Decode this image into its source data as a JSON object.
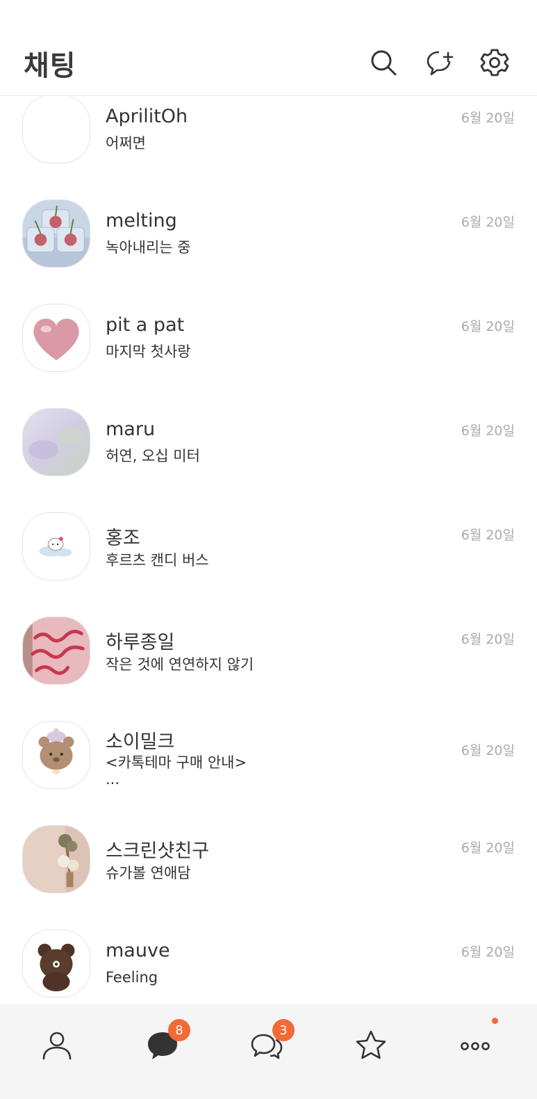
{
  "header": {
    "title": "채팅",
    "icons": [
      "search-icon",
      "new-chat-icon",
      "settings-icon"
    ]
  },
  "chats": [
    {
      "name": "AprilitOh",
      "message": "어쩌면",
      "date": "6월 20일",
      "avatar": "blank"
    },
    {
      "name": "melting",
      "message": "녹아내리는 중",
      "date": "6월 20일",
      "avatar": "ice-cherries"
    },
    {
      "name": "pit a pat",
      "message": "마지막 첫사랑",
      "date": "6월 20일",
      "avatar": "pink-heart"
    },
    {
      "name": "maru",
      "message": "허연, 오십 미터",
      "date": "6월 20일",
      "avatar": "lavender-blur"
    },
    {
      "name": "홍조",
      "message": "후르츠 캔디 버스",
      "date": "6월 20일",
      "avatar": "kitty-cloud"
    },
    {
      "name": "하루종일",
      "message": "작은 것에 연연하지 않기",
      "date": "6월 20일",
      "avatar": "pink-cake"
    },
    {
      "name": "소이밀크",
      "message": "<카톡테마 구매 안내>",
      "message2": "...",
      "date": "6월 20일",
      "avatar": "bear-face"
    },
    {
      "name": "스크린샷친구",
      "message": "슈가볼 연애담",
      "date": "6월 20일",
      "avatar": "dried-flowers"
    },
    {
      "name": "mauve",
      "message": "Feeling",
      "date": "6월 20일",
      "avatar": "brown-bear"
    }
  ],
  "tabbar": {
    "tabs": [
      "friends-tab",
      "chats-tab",
      "openchat-tab",
      "view-tab",
      "more-tab"
    ],
    "chats_badge": "8",
    "openchat_badge": "3",
    "accent": "#f26a35"
  }
}
